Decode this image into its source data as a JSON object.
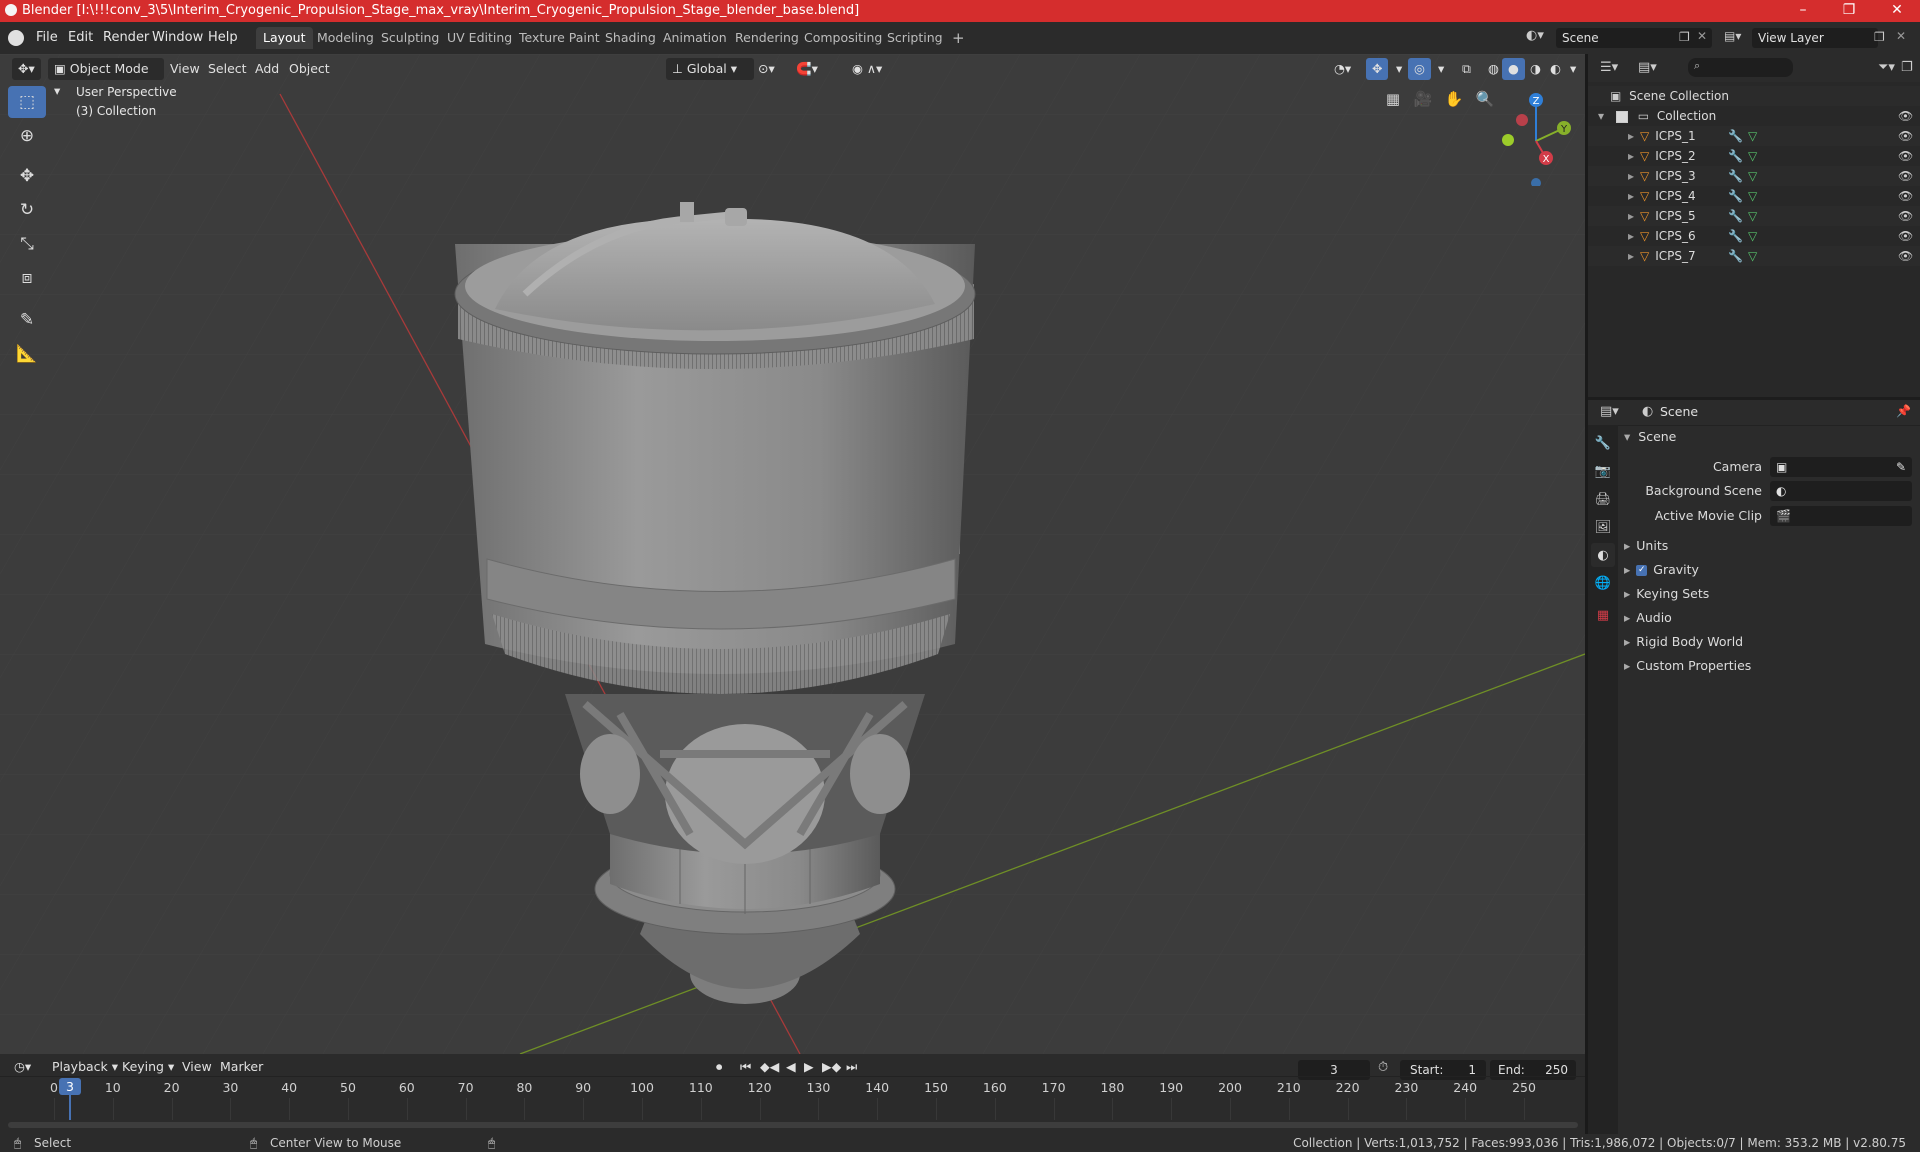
{
  "window": {
    "title": "Blender [I:\\!!!conv_3\\5\\Interim_Cryogenic_Propulsion_Stage_max_vray\\Interim_Cryogenic_Propulsion_Stage_blender_base.blend]",
    "minimize": "–",
    "maximize": "❐",
    "close": "✕"
  },
  "menu": {
    "file": "File",
    "edit": "Edit",
    "render": "Render",
    "window": "Window",
    "help": "Help"
  },
  "workspaces": [
    "Layout",
    "Modeling",
    "Sculpting",
    "UV Editing",
    "Texture Paint",
    "Shading",
    "Animation",
    "Rendering",
    "Compositing",
    "Scripting"
  ],
  "workspace_add": "+",
  "scene_field": "Scene",
  "view_layer_field": "View Layer",
  "viewport": {
    "mode": "Object Mode",
    "view": "View",
    "select": "Select",
    "add": "Add",
    "object": "Object",
    "orientation": "Global",
    "perspective": "User Perspective",
    "collection": "(3) Collection",
    "gizmo": {
      "z": "Z",
      "y": "Y",
      "x": "X"
    }
  },
  "outliner": {
    "root": "Scene Collection",
    "collection": "Collection",
    "items": [
      "ICPS_1",
      "ICPS_2",
      "ICPS_3",
      "ICPS_4",
      "ICPS_5",
      "ICPS_6",
      "ICPS_7"
    ]
  },
  "properties": {
    "header": "Scene",
    "section": "Scene",
    "camera_label": "Camera",
    "background_scene_label": "Background Scene",
    "active_movie_clip_label": "Active Movie Clip",
    "subsections": [
      "Units",
      "Gravity",
      "Keying Sets",
      "Audio",
      "Rigid Body World",
      "Custom Properties"
    ],
    "gravity_checked": true
  },
  "timeline": {
    "playback": "Playback",
    "keying": "Keying",
    "view": "View",
    "marker": "Marker",
    "current_frame": "3",
    "start_label": "Start:",
    "start": "1",
    "end_label": "End:",
    "end": "250",
    "ticks": [
      "0",
      "10",
      "20",
      "30",
      "40",
      "50",
      "60",
      "70",
      "80",
      "90",
      "100",
      "110",
      "120",
      "130",
      "140",
      "150",
      "160",
      "170",
      "180",
      "190",
      "200",
      "210",
      "220",
      "230",
      "240",
      "250"
    ]
  },
  "statusbar": {
    "select": "Select",
    "center_view": "Center View to Mouse",
    "stats": "Collection | Verts:1,013,752 | Faces:993,036 | Tris:1,986,072 | Objects:0/7 | Mem: 353.2 MB | v2.80.75"
  },
  "colors": {
    "accent": "#4772b3",
    "title_bar": "#d52d2d",
    "object_orange": "#e8902a",
    "modifier_blue": "#6aa0e0",
    "mesh_green": "#56c06b",
    "axis_x": "#d23c48",
    "axis_y": "#87b02a",
    "axis_z": "#2f7fd8"
  }
}
